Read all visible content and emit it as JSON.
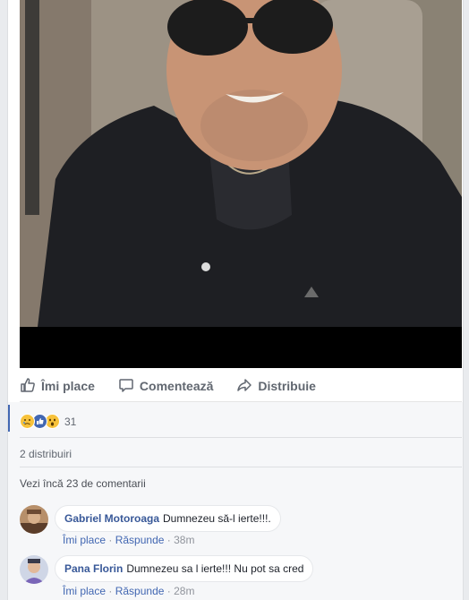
{
  "post": {
    "actions": {
      "like_label": "Îmi place",
      "comment_label": "Comentează",
      "share_label": "Distribuie"
    },
    "reactions": {
      "count": "31",
      "icons": [
        "sad-icon",
        "like-icon",
        "wow-icon"
      ]
    },
    "shares_text": "2 distribuiri",
    "more_comments_text": "Vezi încă 23 de comentarii"
  },
  "comments": [
    {
      "author": "Gabriel Motoroaga",
      "text": "Dumnezeu să-l ierte!!!.",
      "like_label": "Îmi place",
      "reply_label": "Răspunde",
      "time": "38m"
    },
    {
      "author": "Pana Florin",
      "text": "Dumnezeu sa l ierte!!! Nu pot sa cred",
      "like_label": "Îmi place",
      "reply_label": "Răspunde",
      "time": "28m"
    }
  ],
  "colors": {
    "link": "#385898",
    "accent": "#4267b2",
    "muted": "#90949c"
  }
}
